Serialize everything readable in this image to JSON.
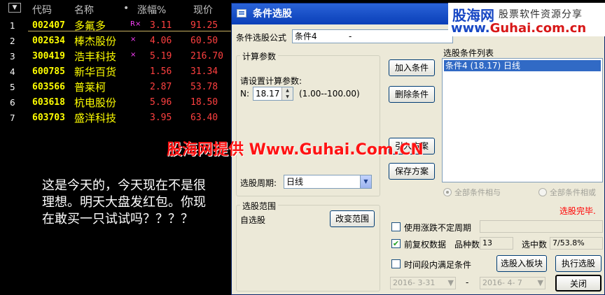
{
  "quote_table": {
    "headers": {
      "sort": "▼",
      "code": "代码",
      "name": "名称",
      "dot": "•",
      "change": "涨幅%",
      "price": "现价"
    },
    "rows": [
      {
        "idx": "1",
        "code": "002407",
        "name": "多氟多",
        "flag": "R×",
        "change": "3.11",
        "price": "91.25"
      },
      {
        "idx": "2",
        "code": "002634",
        "name": "棒杰股份",
        "flag": "×",
        "change": "4.06",
        "price": "60.50"
      },
      {
        "idx": "3",
        "code": "300419",
        "name": "浩丰科技",
        "flag": "×",
        "change": "5.19",
        "price": "216.70"
      },
      {
        "idx": "4",
        "code": "600785",
        "name": "新华百货",
        "flag": "",
        "change": "1.56",
        "price": "31.34"
      },
      {
        "idx": "5",
        "code": "603566",
        "name": "普莱柯",
        "flag": "",
        "change": "2.87",
        "price": "53.78"
      },
      {
        "idx": "6",
        "code": "603618",
        "name": "杭电股份",
        "flag": "",
        "change": "5.96",
        "price": "18.50"
      },
      {
        "idx": "7",
        "code": "603703",
        "name": "盛洋科技",
        "flag": "",
        "change": "3.95",
        "price": "63.40"
      }
    ],
    "comment": "这是今天的，今天现在不是很理想。明天大盘发红包。你现在敢买一只试试吗？？？？"
  },
  "dialog": {
    "title": "条件选股",
    "formula_label": "条件选股公式",
    "formula_value": "条件4",
    "formula_suffix": "-",
    "calc_group": "计算参数",
    "calc_prompt": "请设置计算参数:",
    "param_label": "N:",
    "param_value": "18.17",
    "param_range": "(1.00--100.00)",
    "period_label": "选股周期:",
    "period_value": "日线",
    "range_group": "选股范围",
    "range_value": "自选股",
    "change_range_btn": "改变范围",
    "add_condition_btn": "加入条件",
    "delete_condition_btn": "删除条件",
    "import_plan_btn": "引入方案",
    "save_plan_btn": "保存方案",
    "condition_list_label": "选股条件列表",
    "conditions": [
      "条件4 (18.17) 日线"
    ],
    "radio_all_and": "全部条件相与",
    "radio_all_or": "全部条件相或",
    "status": "选股完毕.",
    "use_period_label": "使用涨跌不定周期",
    "use_period_checked": false,
    "adjusted_label": "前复权数据",
    "adjusted_checked": true,
    "count_label": "品种数",
    "count_value": "13",
    "selected_label": "选中数",
    "selected_value": "7/53.8%",
    "time_range_label": "时间段内满足条件",
    "time_range_checked": false,
    "to_block_btn": "选股入板块",
    "execute_btn": "执行选股",
    "date_from": "2016- 3-31",
    "date_sep": "-",
    "date_to": "2016- 4- 7",
    "close_btn": "关闭"
  },
  "logo": {
    "brand": "股海网",
    "tagline": "股票软件资源分享",
    "url_prefix": "www.",
    "url_main": "Guhai.com.cn"
  },
  "watermark": "股海网提供 Www.Guhai.Com.CN",
  "colors": {
    "bg": "#000000",
    "code_yellow": "#ffff00",
    "up_red": "#ff4040",
    "dialog_bg": "#ece9d8",
    "title_blue": "#0a3fb8",
    "select_blue": "#316ac5"
  }
}
